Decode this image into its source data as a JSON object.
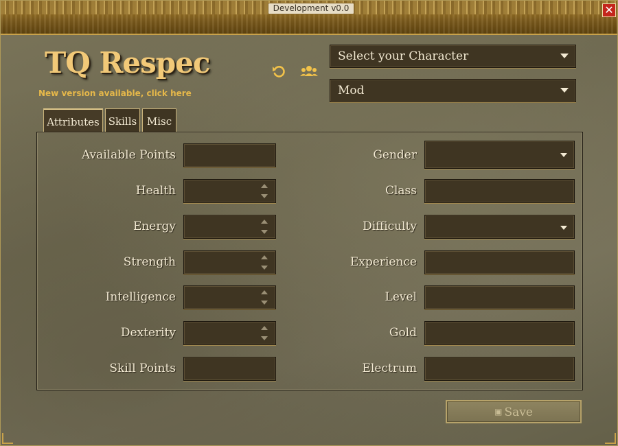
{
  "window": {
    "title": "Development v0.0",
    "close_label": "✕"
  },
  "header": {
    "app_title": "TQ Respec",
    "update_link": "New version available, click here",
    "icons": [
      "undo-icon",
      "users-icon"
    ],
    "character_select": "Select your Character",
    "mod_select": "Mod"
  },
  "tabs": [
    {
      "label": "Attributes",
      "active": true
    },
    {
      "label": "Skills",
      "active": false
    },
    {
      "label": "Misc",
      "active": false
    }
  ],
  "attributes": {
    "left": [
      {
        "label": "Available Points",
        "kind": "text",
        "value": ""
      },
      {
        "label": "Health",
        "kind": "spinner",
        "value": ""
      },
      {
        "label": "Energy",
        "kind": "spinner",
        "value": ""
      },
      {
        "label": "Strength",
        "kind": "spinner",
        "value": ""
      },
      {
        "label": "Intelligence",
        "kind": "spinner",
        "value": ""
      },
      {
        "label": "Dexterity",
        "kind": "spinner",
        "value": ""
      },
      {
        "label": "Skill Points",
        "kind": "text",
        "value": ""
      }
    ],
    "right": [
      {
        "label": "Gender",
        "kind": "dropdown",
        "value": ""
      },
      {
        "label": "Class",
        "kind": "text",
        "value": ""
      },
      {
        "label": "Difficulty",
        "kind": "dropdown",
        "value": ""
      },
      {
        "label": "Experience",
        "kind": "text",
        "value": ""
      },
      {
        "label": "Level",
        "kind": "text",
        "value": ""
      },
      {
        "label": "Gold",
        "kind": "text",
        "value": ""
      },
      {
        "label": "Electrum",
        "kind": "text",
        "value": ""
      }
    ]
  },
  "footer": {
    "save_label": "Save",
    "save_enabled": false
  },
  "colors": {
    "accent_gold": "#f2c978",
    "link": "#e6b84a",
    "field_bg": "#3f3522",
    "close_red": "#c4261d"
  }
}
